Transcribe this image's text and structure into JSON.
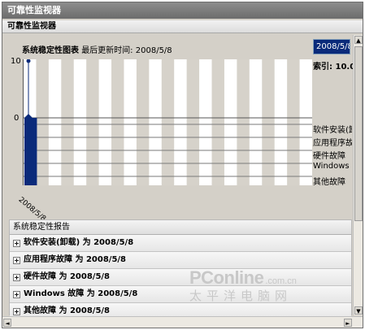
{
  "window": {
    "title": "可靠性监视器"
  },
  "panel": {
    "title": "可靠性监视器"
  },
  "chart_header": {
    "title": "系统稳定性图表",
    "last_update_label": "最后更新时间:",
    "last_update_value": "2008/5/8",
    "selected_date": "2008/5/8"
  },
  "legend": {
    "index_label": "索引: 10.0",
    "categories": [
      "软件安装(卸载)",
      "应用程序故障",
      "硬件故障",
      "Windows",
      "其他故障"
    ]
  },
  "chart_data": {
    "type": "bar",
    "categories": [
      "2008/5/8"
    ],
    "values": [
      10.0
    ],
    "ylim": [
      0,
      10
    ],
    "yticks": [
      "10",
      "0"
    ],
    "x_tick_labels": [
      "2008/5/8"
    ],
    "column_count": 23,
    "accent_color": "#0a2a7a"
  },
  "report": {
    "header": "系统稳定性报告",
    "rows": [
      {
        "label": "软件安装(卸载) 为 2008/5/8"
      },
      {
        "label": "应用程序故障 为 2008/5/8"
      },
      {
        "label": "硬件故障 为 2008/5/8"
      },
      {
        "label": "Windows 故障 为 2008/5/8"
      },
      {
        "label": "其他故障 为 2008/5/8"
      }
    ],
    "expander_symbol": "+"
  },
  "watermark": {
    "brand": "PConline",
    "domain": ".com.cn",
    "chinese": "太平洋电脑网"
  },
  "scrollbar": {
    "up": "▲",
    "down": "▼",
    "left": "◄",
    "right": "►"
  }
}
